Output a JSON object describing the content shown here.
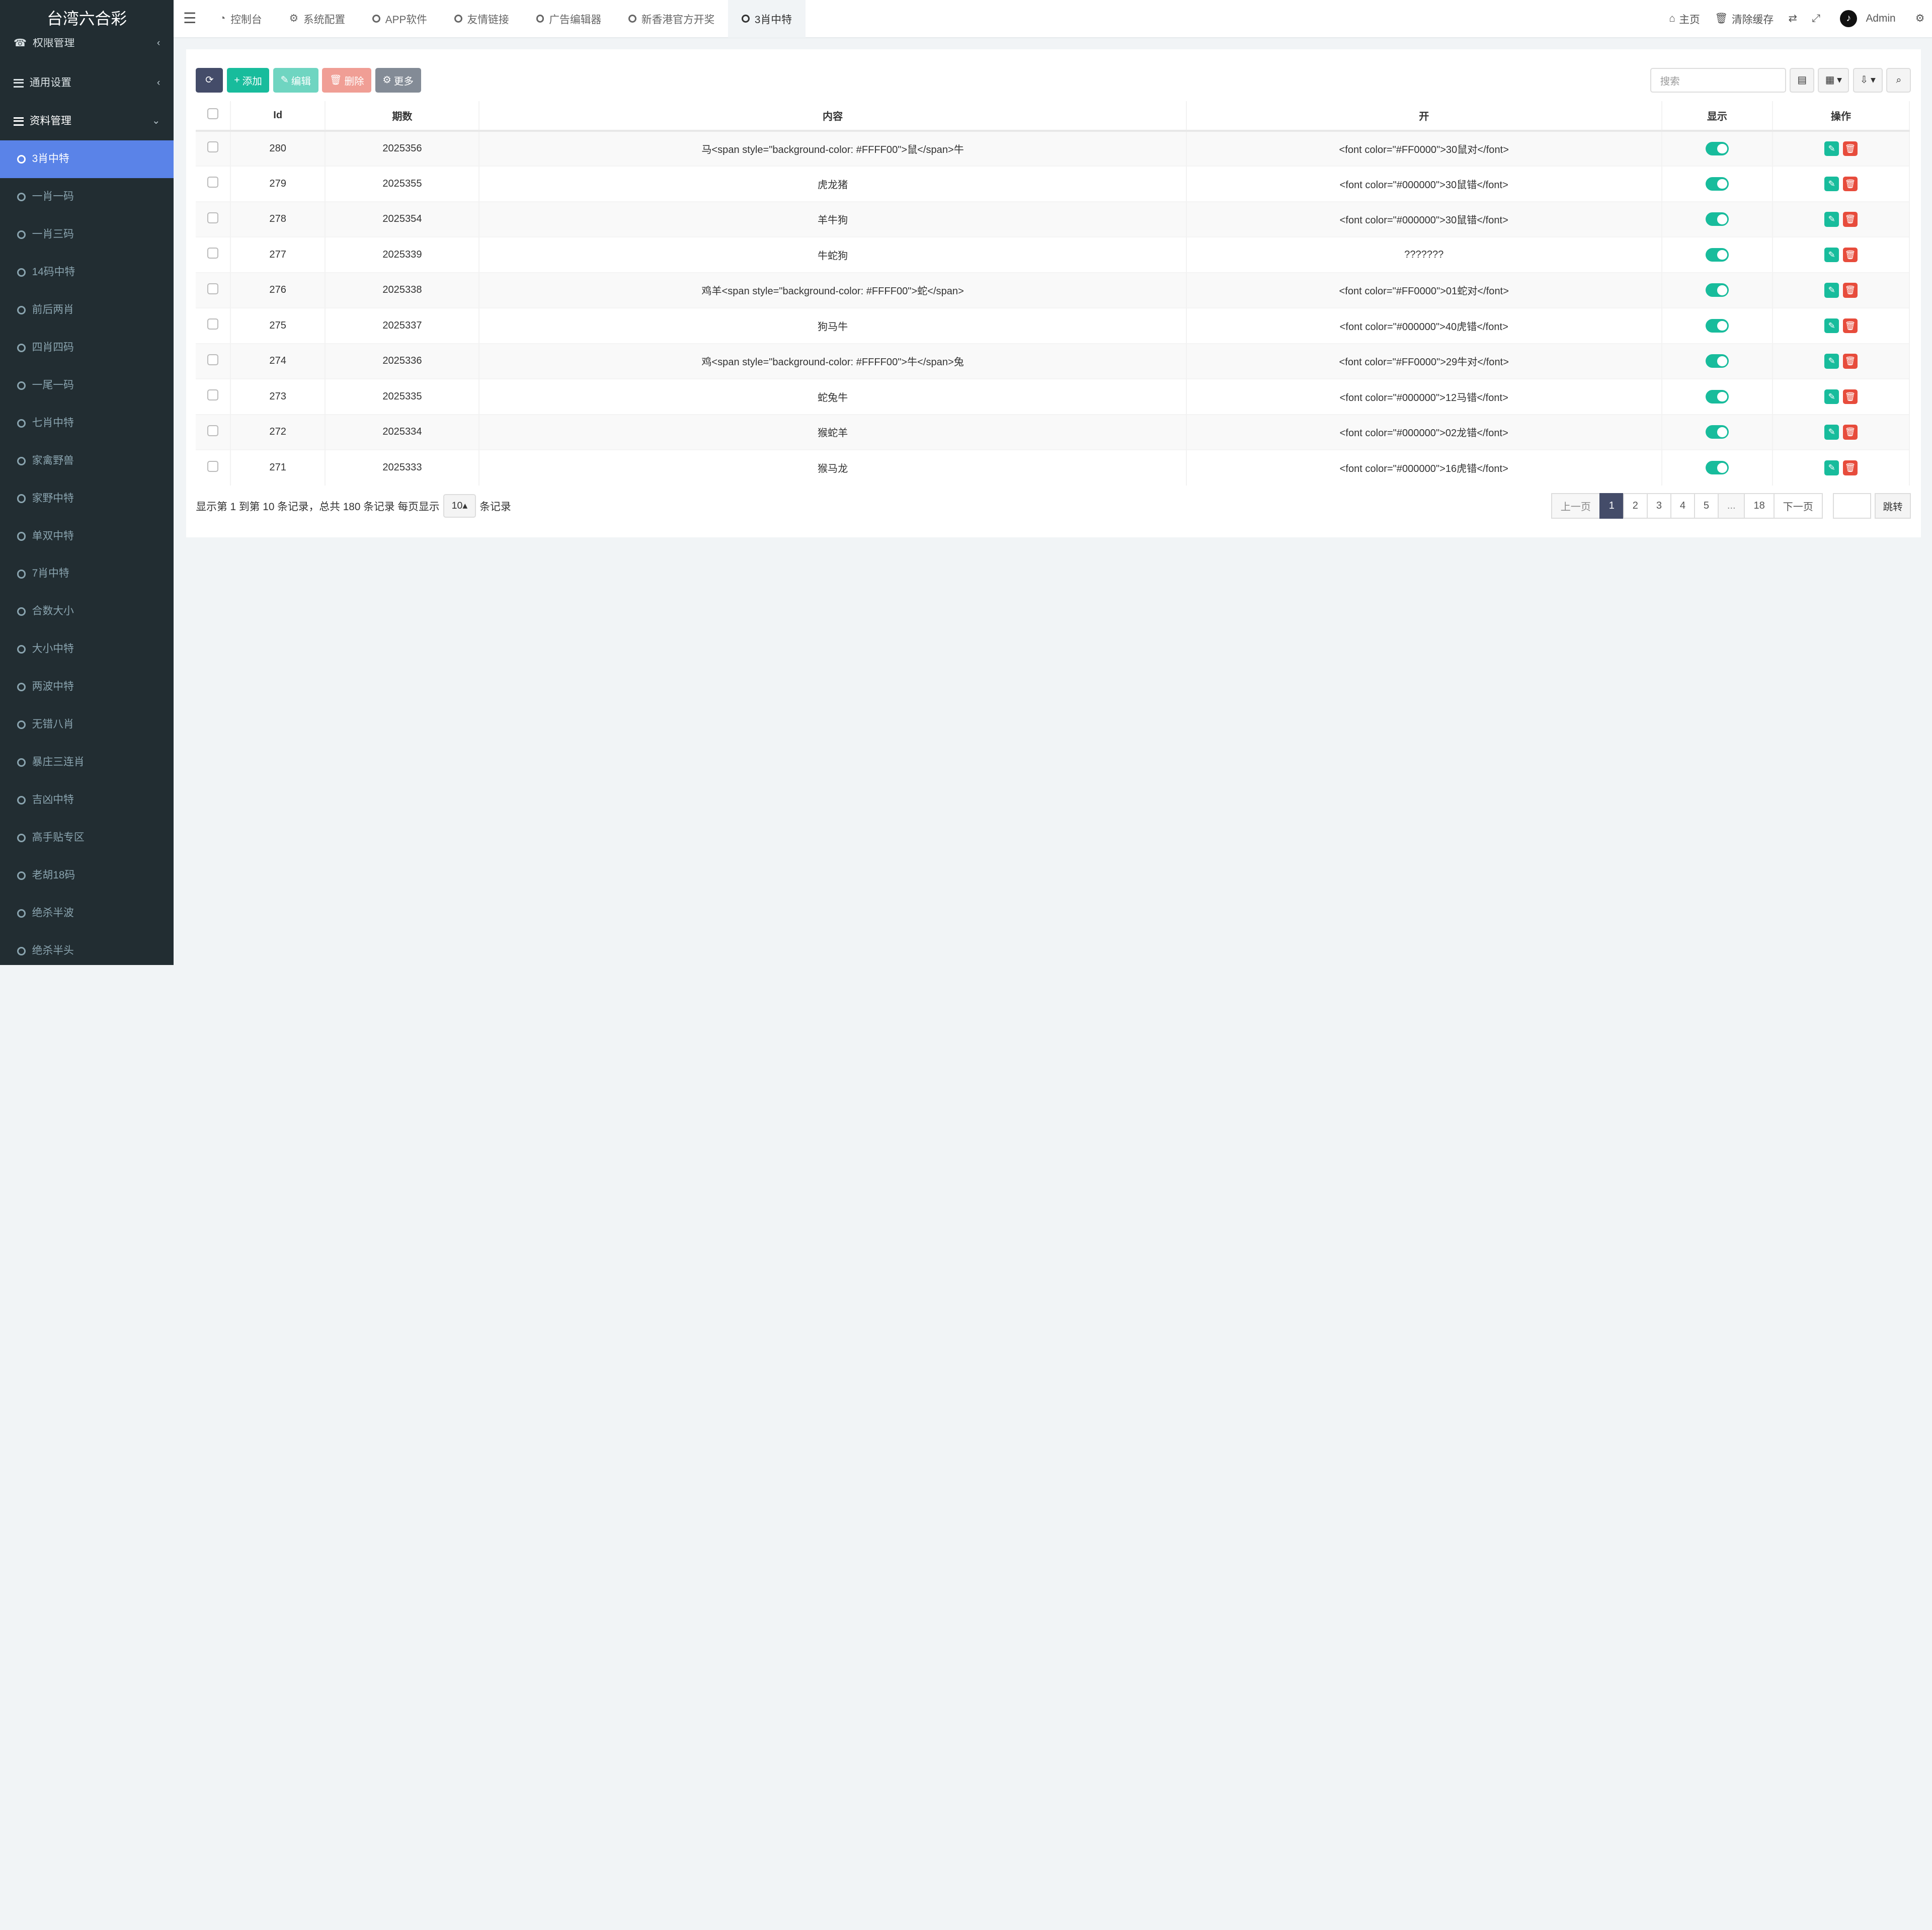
{
  "sidebar": {
    "brand": "台湾六合彩",
    "top_items": [
      {
        "label": "权限管理",
        "chev": "‹"
      },
      {
        "label": "通用设置",
        "chev": "‹"
      },
      {
        "label": "资料管理",
        "chev": "⌄"
      }
    ],
    "items": [
      "3肖中特",
      "一肖一码",
      "一肖三码",
      "14码中特",
      "前后两肖",
      "四肖四码",
      "一尾一码",
      "七肖中特",
      "家禽野兽",
      "家野中特",
      "单双中特",
      "7肖中特",
      "合数大小",
      "大小中特",
      "两波中特",
      "无错八肖",
      "暴庄三连肖",
      "吉凶中特",
      "高手贴专区",
      "老胡18码",
      "绝杀半波",
      "绝杀半头"
    ]
  },
  "topnav": {
    "tabs": [
      "控制台",
      "系统配置",
      "APP软件",
      "友情链接",
      "广告编辑器",
      "新香港官方开奖",
      "3肖中特"
    ],
    "home": "主页",
    "clear_cache": "清除缓存",
    "user": "Admin"
  },
  "toolbar": {
    "add": "添加",
    "edit": "编辑",
    "delete": "删除",
    "more": "更多",
    "search_placeholder": "搜索"
  },
  "table": {
    "headers": [
      "Id",
      "期数",
      "内容",
      "开",
      "显示",
      "操作"
    ],
    "rows": [
      {
        "id": "280",
        "period": "2025356",
        "content": "马<span style=\"background-color: #FFFF00\">鼠</span>牛",
        "open": "<font color=\"#FF0000\">30鼠对</font>"
      },
      {
        "id": "279",
        "period": "2025355",
        "content": "虎龙猪",
        "open": "<font color=\"#000000\">30鼠错</font>"
      },
      {
        "id": "278",
        "period": "2025354",
        "content": "羊牛狗",
        "open": "<font color=\"#000000\">30鼠错</font>"
      },
      {
        "id": "277",
        "period": "2025339",
        "content": "牛蛇狗",
        "open": "???????"
      },
      {
        "id": "276",
        "period": "2025338",
        "content": "鸡羊<span style=\"background-color: #FFFF00\">蛇</span>",
        "open": "<font color=\"#FF0000\">01蛇对</font>"
      },
      {
        "id": "275",
        "period": "2025337",
        "content": "狗马牛",
        "open": "<font color=\"#000000\">40虎错</font>"
      },
      {
        "id": "274",
        "period": "2025336",
        "content": "鸡<span style=\"background-color: #FFFF00\">牛</span>兔",
        "open": "<font color=\"#FF0000\">29牛对</font>"
      },
      {
        "id": "273",
        "period": "2025335",
        "content": "蛇兔牛",
        "open": "<font color=\"#000000\">12马错</font>"
      },
      {
        "id": "272",
        "period": "2025334",
        "content": "猴蛇羊",
        "open": "<font color=\"#000000\">02龙错</font>"
      },
      {
        "id": "271",
        "period": "2025333",
        "content": "猴马龙",
        "open": "<font color=\"#000000\">16虎错</font>"
      }
    ]
  },
  "footer": {
    "summary": "显示第 1 到第 10 条记录，总共 180 条记录 每页显示",
    "page_size": "10",
    "suffix": "条记录"
  },
  "pager": {
    "prev": "上一页",
    "pages": [
      "1",
      "2",
      "3",
      "4",
      "5",
      "...",
      "18"
    ],
    "next": "下一页",
    "jump": "跳转"
  },
  "colors": {
    "sidebar_bg": "#222d32",
    "active_item": "#5a83e8",
    "accent_green": "#18bc9c",
    "danger": "#e74c3c",
    "dark_btn": "#444c69"
  }
}
